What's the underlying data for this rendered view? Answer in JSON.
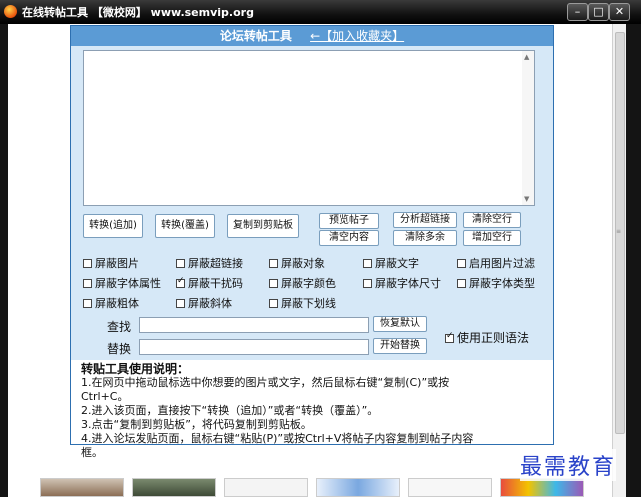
{
  "window": {
    "title": "在线转帖工具 【微校网】 www.semvip.org",
    "min": "–",
    "max": "□",
    "close": "✕"
  },
  "header": {
    "title": "论坛转帖工具",
    "favorite_link": "←【加入收藏夹】"
  },
  "buttons": {
    "convert_append": "转换(追加)",
    "convert_overwrite": "转换(覆盖)",
    "copy_clipboard": "复制到剪贴板",
    "preview_post": "预览帖子",
    "clear_content": "清空内容",
    "analyze_links": "分析超链接",
    "clear_extra": "清除多余",
    "clear_blank_lines": "清除空行",
    "add_blank_lines": "增加空行",
    "restore_default": "恢复默认",
    "start_replace": "开始替换"
  },
  "options": [
    {
      "label": "屏蔽图片",
      "checked": false
    },
    {
      "label": "屏蔽超链接",
      "checked": false
    },
    {
      "label": "屏蔽对象",
      "checked": false
    },
    {
      "label": "屏蔽文字",
      "checked": false
    },
    {
      "label": "启用图片过滤",
      "checked": false
    },
    {
      "label": "屏蔽字体属性",
      "checked": false
    },
    {
      "label": "屏蔽干扰码",
      "checked": true
    },
    {
      "label": "屏蔽字颜色",
      "checked": false
    },
    {
      "label": "屏蔽字体尺寸",
      "checked": false
    },
    {
      "label": "屏蔽字体类型",
      "checked": false
    },
    {
      "label": "屏蔽粗体",
      "checked": false
    },
    {
      "label": "屏蔽斜体",
      "checked": false
    },
    {
      "label": "屏蔽下划线",
      "checked": false
    }
  ],
  "find": {
    "label": "查找",
    "value": ""
  },
  "replace": {
    "label": "替换",
    "value": ""
  },
  "regex": {
    "label": "使用正则语法",
    "checked": true
  },
  "instructions": {
    "heading": "转贴工具使用说明：",
    "lines": [
      "1.在网页中拖动鼠标选中你想要的图片或文字，然后鼠标右键“复制(C)”或按",
      "Ctrl+C。",
      "2.进入该页面，直接按下“转换（追加）”或者“转换（覆盖）”。",
      "3.点击“复制到剪贴板”，将代码复制到剪贴板。",
      "4.进入论坛发贴页面，鼠标右键“粘贴(P)”或按Ctrl+V将帖子内容复制到帖子内容",
      "框。"
    ]
  },
  "watermark": "最需教育",
  "colors": {
    "header_blue": "#5b9bd5",
    "body_blue": "#d6e8f7",
    "watermark": "#2a43c9"
  }
}
